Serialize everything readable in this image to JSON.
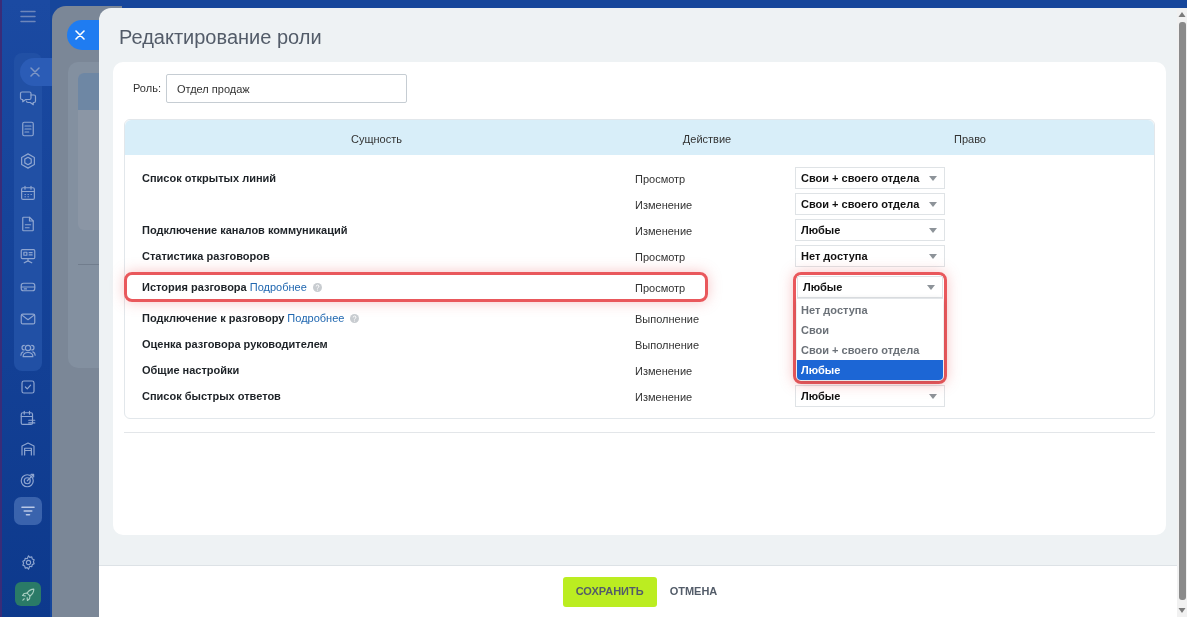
{
  "sidebar": {
    "pinned_items": [
      {
        "kind": "chat",
        "selected": false
      },
      {
        "kind": "news",
        "selected": false
      },
      {
        "kind": "hexagon",
        "selected": false
      },
      {
        "kind": "calendar",
        "selected": false
      },
      {
        "kind": "document",
        "selected": false
      },
      {
        "kind": "board",
        "selected": false
      },
      {
        "kind": "drive",
        "selected": false
      },
      {
        "kind": "mail",
        "selected": false
      },
      {
        "kind": "contacts",
        "selected": false
      }
    ],
    "items": [
      {
        "kind": "task",
        "selected": false
      },
      {
        "kind": "calendar_list",
        "selected": false
      },
      {
        "kind": "store",
        "selected": false
      },
      {
        "kind": "target",
        "selected": false
      },
      {
        "kind": "funnel",
        "selected": true
      }
    ],
    "bottom_items": [
      {
        "kind": "gear"
      },
      {
        "kind": "rocket"
      }
    ]
  },
  "dialog": {
    "title": "Редактирование роли",
    "role": {
      "label": "Роль:",
      "value": "Отдел продаж"
    },
    "table": {
      "columns": [
        "Сущность",
        "Действие",
        "Право"
      ],
      "rows": [
        {
          "entity": "Список открытых линий",
          "action": "Просмотр",
          "permission": "Свои + своего отдела",
          "highlighted": false,
          "open": false
        },
        {
          "action": "Изменение",
          "permission": "Свои + своего отдела",
          "highlighted": false,
          "open": false
        },
        {
          "entity": "Подключение каналов коммуникаций",
          "action": "Изменение",
          "permission": "Любые",
          "highlighted": false,
          "open": false
        },
        {
          "entity": "Статистика разговоров",
          "action": "Просмотр",
          "permission": "Нет доступа",
          "highlighted": false,
          "open": false
        },
        {
          "entity": "История разговора",
          "link": "Подробнее",
          "action": "Просмотр",
          "permission": "Любые",
          "highlighted": true,
          "open": true,
          "options": [
            {
              "label": "Нет доступа",
              "selected": false
            },
            {
              "label": "Свои",
              "selected": false
            },
            {
              "label": "Свои + своего отдела",
              "selected": false
            },
            {
              "label": "Любые",
              "selected": true
            }
          ]
        },
        {
          "entity": "Подключение к разговору",
          "link": "Подробнее",
          "action": "Выполнение",
          "highlighted": false,
          "open": false
        },
        {
          "entity": "Оценка разговора руководителем",
          "action": "Выполнение",
          "highlighted": false,
          "open": false
        },
        {
          "entity": "Общие настройки",
          "action": "Изменение",
          "highlighted": false,
          "open": false
        },
        {
          "entity": "Список быстрых ответов",
          "action": "Изменение",
          "permission": "Любые",
          "highlighted": false,
          "open": false
        }
      ]
    }
  },
  "footer": {
    "buttons": [
      {
        "label": "СОХРАНИТЬ",
        "kind": "primary"
      },
      {
        "label": "ОТМЕНА",
        "kind": "link"
      }
    ]
  }
}
